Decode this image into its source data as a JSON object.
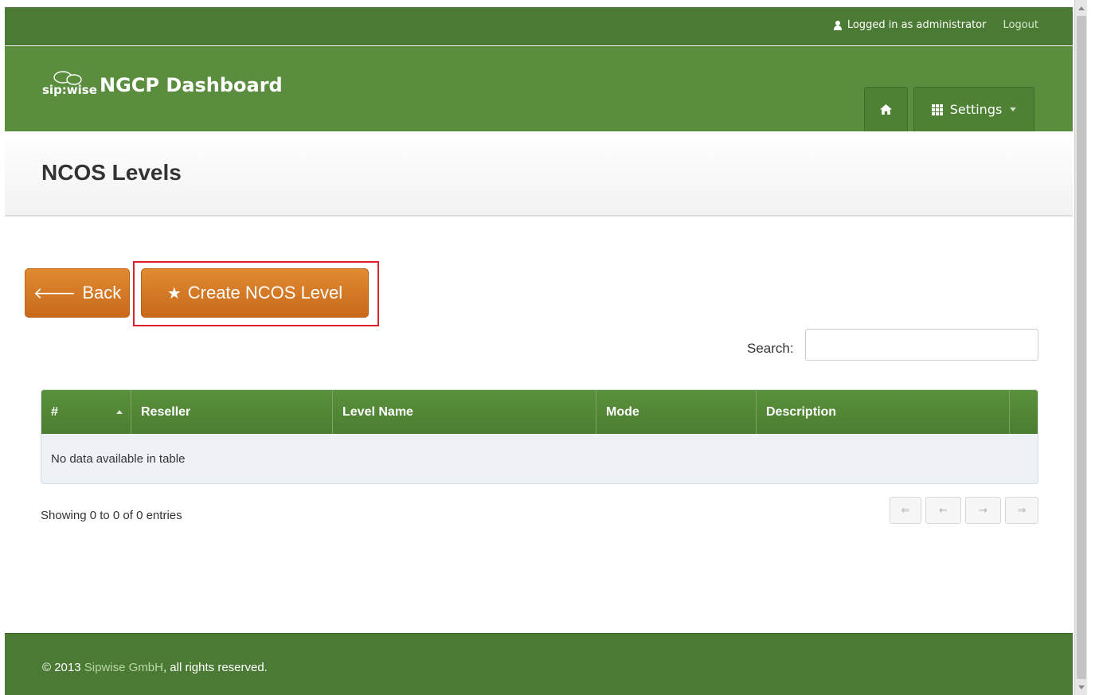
{
  "topbar": {
    "logged_in_text": "Logged in as administrator",
    "logout_label": "Logout",
    "user_icon": "user-icon"
  },
  "header": {
    "logo_text": "sip:wise",
    "title": "NGCP Dashboard",
    "home_icon": "home-icon",
    "settings_icon": "grid-icon",
    "settings_label": "Settings"
  },
  "page": {
    "title": "NCOS Levels"
  },
  "actions": {
    "back_label": "Back",
    "back_icon": "arrow-left-icon",
    "create_label": "Create NCOS Level",
    "create_icon": "star-icon",
    "highlight_color": "#e0202a"
  },
  "search": {
    "label": "Search:",
    "value": ""
  },
  "table": {
    "columns": [
      "#",
      "Reseller",
      "Level Name",
      "Mode",
      "Description",
      ""
    ],
    "empty_message": "No data available in table",
    "sorted_column": "#",
    "sort_direction": "ascending"
  },
  "pagination": {
    "summary": "Showing 0 to 0 of 0 entries",
    "first": "⇐",
    "prev": "←",
    "next": "→",
    "last": "⇒"
  },
  "footer": {
    "prefix": "© 2013 ",
    "company": "Sipwise GmbH",
    "suffix": ", all rights reserved."
  },
  "colors": {
    "topbar": "#4a7a34",
    "header": "#5a8e3e",
    "button_orange": "#d77a27",
    "table_header": "#52873a",
    "footer": "#4a7a34"
  }
}
